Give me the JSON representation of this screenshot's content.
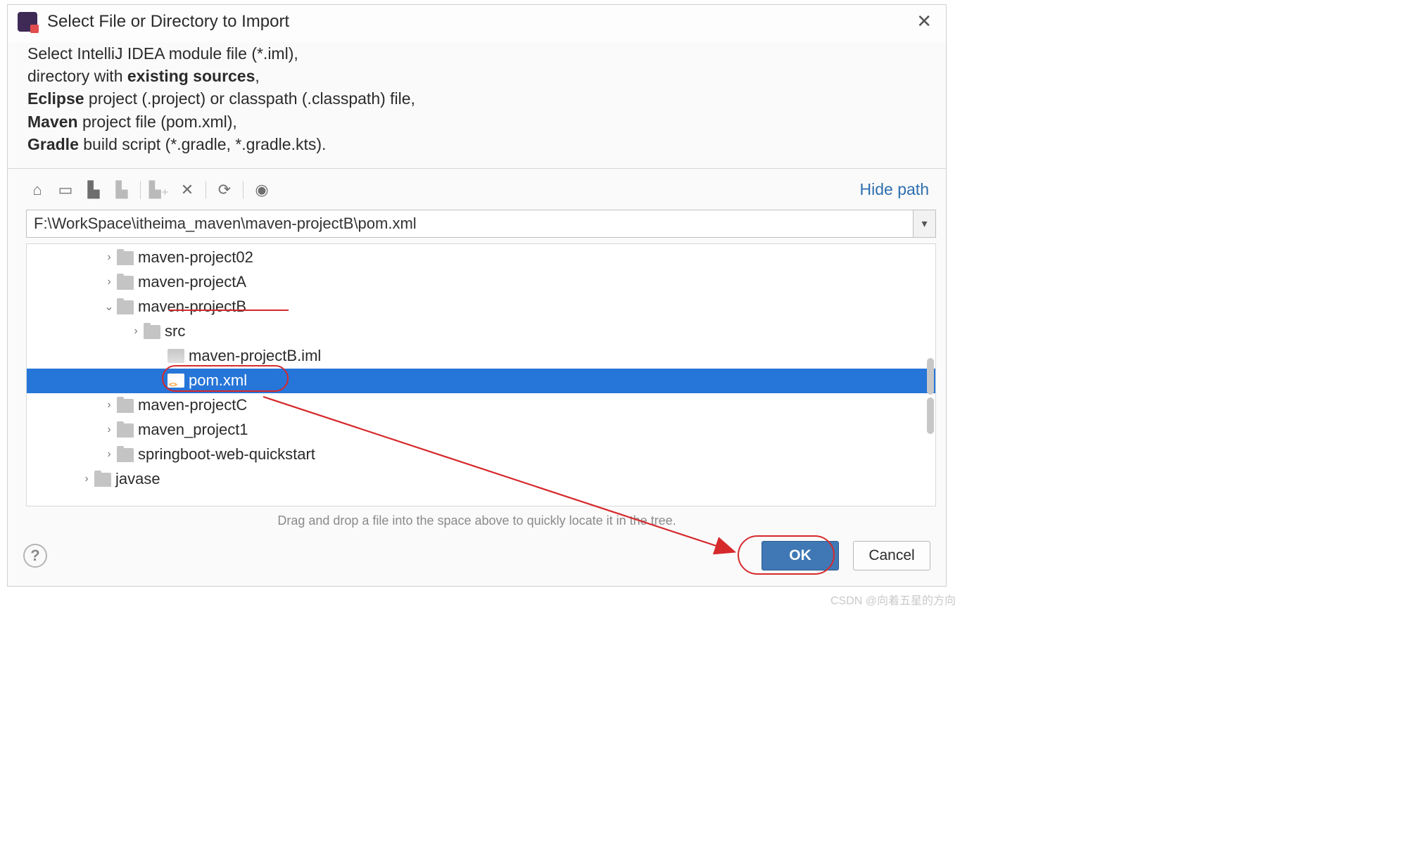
{
  "title": "Select File or Directory to Import",
  "instructions": {
    "l1a": "Select IntelliJ IDEA module file (*.iml),",
    "l2a": "directory with ",
    "l2b": "existing sources",
    "l2c": ",",
    "l3a": "Eclipse",
    "l3b": " project (.project) or classpath (.classpath) file,",
    "l4a": "Maven",
    "l4b": " project file (pom.xml),",
    "l5a": "Gradle",
    "l5b": " build script (*.gradle, *.gradle.kts)."
  },
  "toolbar": {
    "hide_path": "Hide path"
  },
  "path": "F:\\WorkSpace\\itheima_maven\\maven-projectB\\pom.xml",
  "tree": [
    {
      "indent": "ind0",
      "arrow": ">",
      "type": "folder",
      "label": "maven-project02"
    },
    {
      "indent": "ind0",
      "arrow": ">",
      "type": "folder",
      "label": "maven-projectA"
    },
    {
      "indent": "ind0",
      "arrow": "v",
      "type": "folder",
      "label": "maven-projectB"
    },
    {
      "indent": "ind1",
      "arrow": ">",
      "type": "folder",
      "label": "src"
    },
    {
      "indent": "ind2",
      "arrow": "",
      "type": "iml",
      "label": "maven-projectB.iml"
    },
    {
      "indent": "ind2",
      "arrow": "",
      "type": "pom",
      "label": "pom.xml",
      "selected": true
    },
    {
      "indent": "ind0",
      "arrow": ">",
      "type": "folder",
      "label": "maven-projectC"
    },
    {
      "indent": "ind0",
      "arrow": ">",
      "type": "folder",
      "label": "maven_project1"
    },
    {
      "indent": "ind0",
      "arrow": ">",
      "type": "folder",
      "label": "springboot-web-quickstart"
    },
    {
      "indent": "indj",
      "arrow": ">",
      "type": "folder",
      "label": "javase"
    }
  ],
  "hint": "Drag and drop a file into the space above to quickly locate it in the tree.",
  "buttons": {
    "ok": "OK",
    "cancel": "Cancel"
  },
  "watermark": "CSDN @向着五星的方向"
}
